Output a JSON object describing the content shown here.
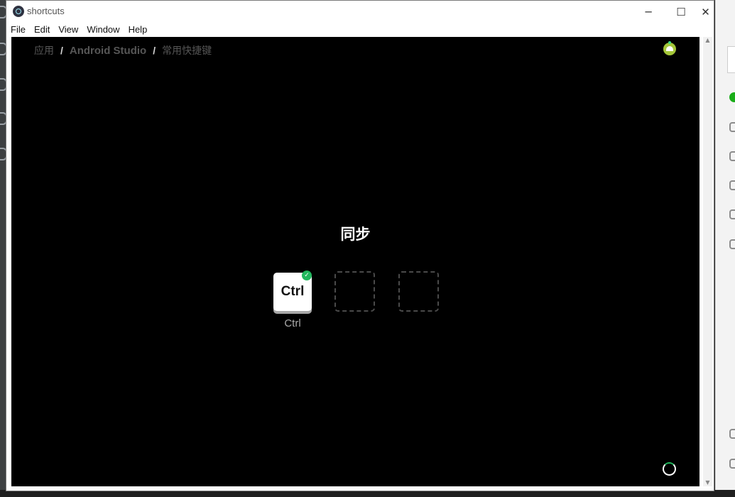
{
  "window": {
    "title": "shortcuts",
    "controls": {
      "minimize": "─",
      "maximize": "☐",
      "close": "✕"
    }
  },
  "menubar": [
    "File",
    "Edit",
    "View",
    "Window",
    "Help"
  ],
  "breadcrumb": {
    "items": [
      "应用",
      "Android Studio",
      "常用快捷键"
    ],
    "separator": "/"
  },
  "main": {
    "heading": "同步",
    "keys": [
      {
        "label": "Ctrl",
        "caption": "Ctrl",
        "done": true,
        "check": "✓"
      }
    ],
    "empty_slots": 2
  },
  "icons": {
    "avatar": "android-avatar-icon",
    "loading": "loading-spinner-icon"
  },
  "colors": {
    "background": "#000000",
    "accent": "#21b75d",
    "muted_text": "#565656"
  }
}
